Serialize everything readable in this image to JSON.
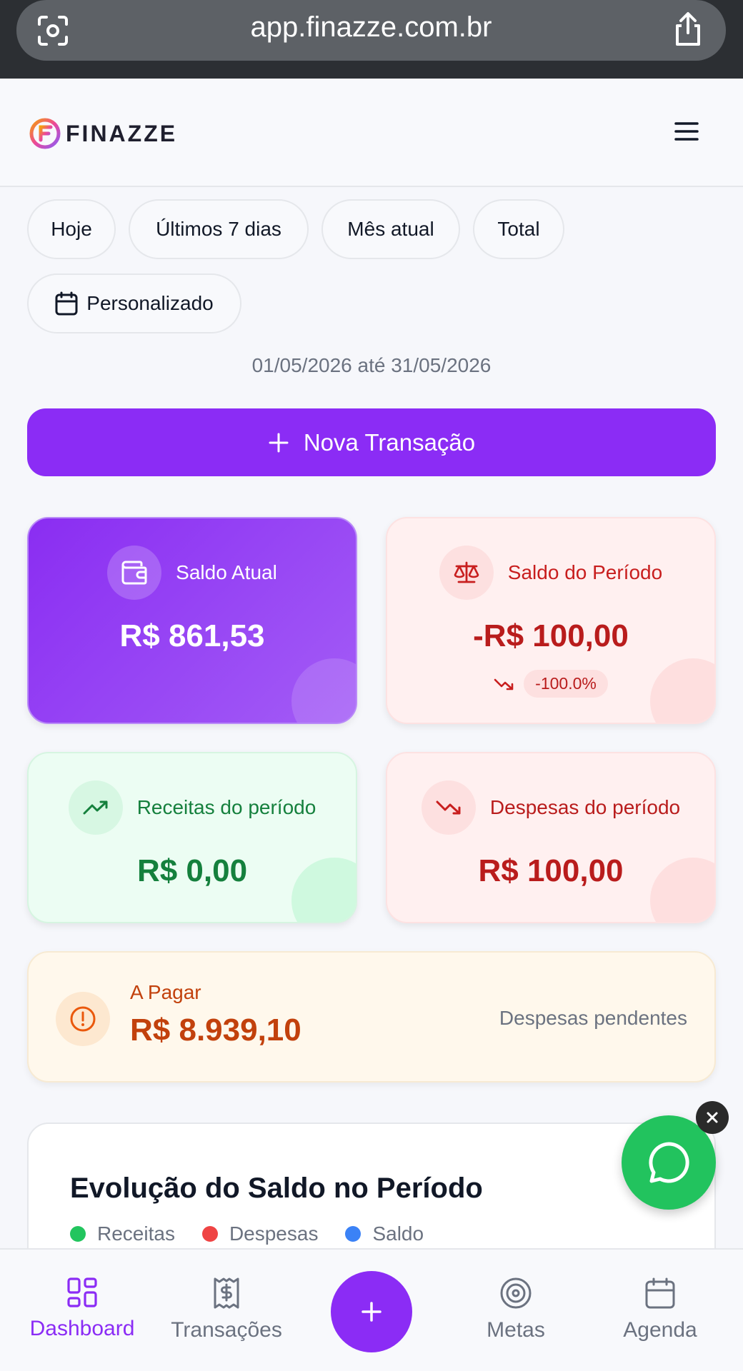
{
  "browser": {
    "url": "app.finazze.com.br"
  },
  "brand": {
    "name": "FINAZZE",
    "accent": "#8b2cf5"
  },
  "filters": {
    "chips": [
      "Hoje",
      "Últimos 7 dias",
      "Mês atual",
      "Total"
    ],
    "custom": "Personalizado",
    "date_range": "01/05/2026 até 31/05/2026"
  },
  "actions": {
    "new_transaction": "Nova Transação"
  },
  "cards": {
    "saldo_atual": {
      "title": "Saldo Atual",
      "value": "R$ 861,53"
    },
    "saldo_periodo": {
      "title": "Saldo do Período",
      "value": "-R$ 100,00",
      "change": "-100.0%"
    },
    "receitas": {
      "title": "Receitas do período",
      "value": "R$ 0,00"
    },
    "despesas": {
      "title": "Despesas do período",
      "value": "R$ 100,00"
    }
  },
  "a_pagar": {
    "label": "A Pagar",
    "value": "R$ 8.939,10",
    "note": "Despesas pendentes"
  },
  "chart": {
    "title": "Evolução do Saldo no Período",
    "legend": [
      {
        "label": "Receitas",
        "color": "#22c55e"
      },
      {
        "label": "Despesas",
        "color": "#ef4444"
      },
      {
        "label": "Saldo",
        "color": "#3b82f6"
      }
    ]
  },
  "nav": {
    "dashboard": "Dashboard",
    "transacoes": "Transações",
    "metas": "Metas",
    "agenda": "Agenda"
  }
}
